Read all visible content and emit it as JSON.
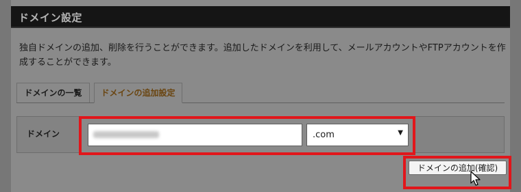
{
  "header": {
    "title": "ドメイン設定"
  },
  "description": "独自ドメインの追加、削除を行うことができます。追加したドメインを利用して、メールアカウントやFTPアカウントを作成することができます。",
  "tabs": [
    {
      "label": "ドメインの一覧",
      "active": false
    },
    {
      "label": "ドメインの追加設定",
      "active": true
    }
  ],
  "form": {
    "domain_label": "ドメイン",
    "domain_input": {
      "value": "",
      "placeholder": ""
    },
    "tld_select": {
      "value": ".com"
    },
    "add_button": "ドメインの追加(確認)"
  },
  "colors": {
    "highlight": "#e1161b",
    "active_tab_text": "#6a4510",
    "header_bg": "#151515"
  },
  "icons": [
    "chevron-down-icon",
    "mouse-cursor-icon"
  ]
}
